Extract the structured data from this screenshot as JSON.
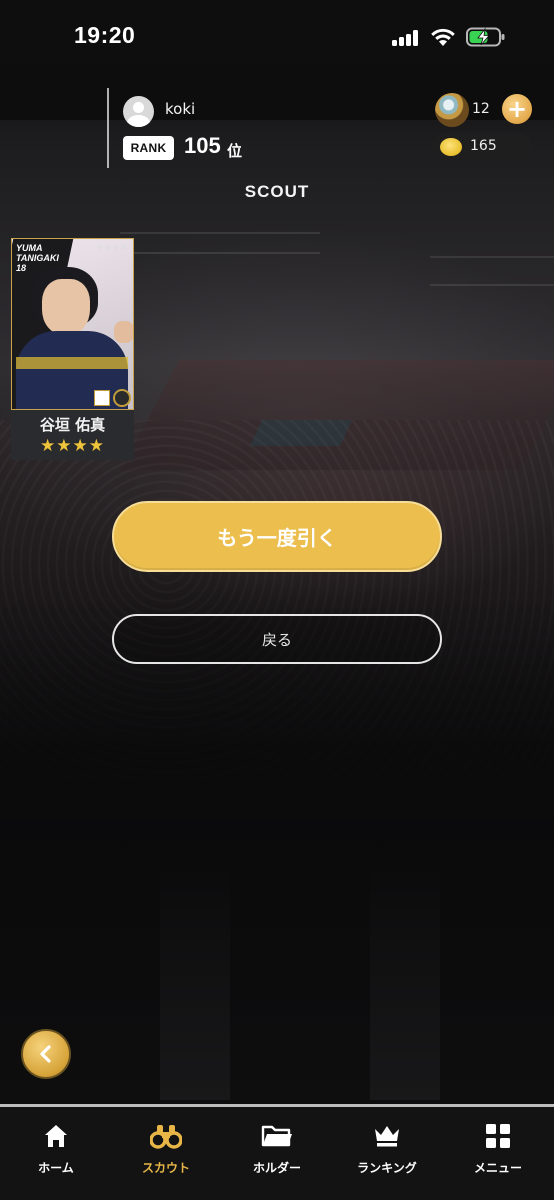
{
  "status_bar": {
    "time": "19:20"
  },
  "user": {
    "name": "koki",
    "rank_badge": "RANK",
    "rank_value": "105",
    "rank_suffix": "位"
  },
  "currency": {
    "gems": "12",
    "coins": "165"
  },
  "page": {
    "title": "SCOUT"
  },
  "card": {
    "name_vertical": "YUMA\nTANIGAKI\n18",
    "player_name": "谷垣 佑真",
    "rarity_stars": 4,
    "stars_text": "★★★★",
    "mini_stars": "★★★★"
  },
  "actions": {
    "draw_again": "もう一度引く",
    "back": "戻る"
  },
  "tabs": [
    {
      "label": "ホーム",
      "icon": "home-icon",
      "active": false
    },
    {
      "label": "スカウト",
      "icon": "binoculars-icon",
      "active": true
    },
    {
      "label": "ホルダー",
      "icon": "folder-icon",
      "active": false
    },
    {
      "label": "ランキング",
      "icon": "crown-icon",
      "active": false
    },
    {
      "label": "メニュー",
      "icon": "grid-icon",
      "active": false
    }
  ],
  "colors": {
    "accent": "#ebbe4d",
    "active_tab": "#e7b647",
    "star": "#f0c43a"
  }
}
